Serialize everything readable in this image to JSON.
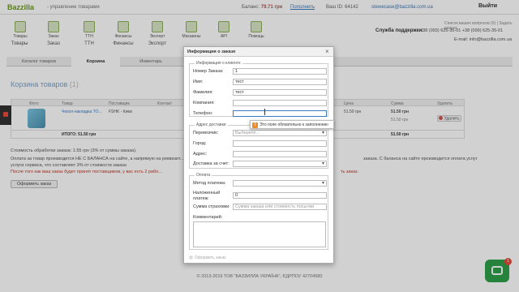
{
  "topbar": {
    "logo": "Bazzilla",
    "logo_sub": "- управление товарами",
    "balance_label": "Баланс:",
    "balance_value": "79.71 грн",
    "topup": "Пополнить",
    "uid": "Ваш ID: 64142",
    "email": "stewecase@bazzilla.com.ua",
    "logout": "Выйти"
  },
  "iconbar": {
    "items": [
      {
        "label": "Товары",
        "icon": "stack-icon"
      },
      {
        "label": "Заказ",
        "icon": "cart-icon"
      },
      {
        "label": "ТТН",
        "icon": "document-icon"
      },
      {
        "label": "Финансы",
        "icon": "money-icon"
      },
      {
        "label": "Экспорт",
        "icon": "export-icon"
      },
      {
        "label": "Магазины",
        "icon": "store-icon"
      },
      {
        "label": "API",
        "icon": "gear-icon"
      },
      {
        "label": "Помощь",
        "icon": "help-icon"
      }
    ],
    "quick_links": "Список ваших вопросов (0) | Задать вопрос",
    "support_label": "Служба поддержки:",
    "phones": "+38 (093) 625-35-01  +38 (099) 625-35-01",
    "mail": "E-mail: info@bazzilla.com.ua"
  },
  "tabs_top": [
    "Товары",
    "Заказ",
    "ТТН",
    "Финансы",
    "Экспорт",
    "Магазины",
    "API",
    "Помощь"
  ],
  "tabs_second": [
    "Каталог товаров",
    "Корзина",
    "Инвентарь",
    "",
    "",
    ""
  ],
  "cart": {
    "title": "Корзина товаров",
    "count": "(1)",
    "headers": [
      "Фото",
      "Товар",
      "Поставщик",
      "Контакт",
      "Цена",
      "Сумма",
      "Удалить"
    ],
    "row": {
      "product": "Чехол-накладка TO...",
      "supplier": "FSHK - Киев",
      "price": "51.50 грн",
      "sum": "51.50 грн",
      "sum2": "51.50 грн",
      "delete": "Удалить"
    },
    "total_label": "ИТОГО: 51.50 грн",
    "total_sum": "51.50 грн"
  },
  "info": {
    "line1": "Стоимость обработки заказа: 1.55 грн (3% от суммы заказа).",
    "line2": "Оплата за товар производится НЕ С БАЛАНСА на сайте, а напрямую на реквизит...",
    "line3": "услуги сервиса, что составляет 3% от стоимости заказа",
    "line4": "После того как ваш заказ будет принят поставщиком, у вас есть 2 рабо...",
    "right2": "заказа. С баланса на сайте производится оплата услуг",
    "right4": "ть заказ.",
    "order_button": "Оформить заказ"
  },
  "footer": "© 2013-2019 ТОВ \"БАЗЗИЛЛА УКРАЇНА\", ЄДРПОУ 42704580",
  "chat": {
    "badge": "1"
  },
  "modal": {
    "title": "Информация о заказе",
    "close": "×",
    "client_legend": "Информация о клиенте",
    "fields_client": [
      {
        "label": "Номер Заказа:",
        "value": "1"
      },
      {
        "label": "Имя:",
        "value": "тест"
      },
      {
        "label": "Фамилия:",
        "value": "тест"
      },
      {
        "label": "Компания:",
        "value": ""
      },
      {
        "label": "Телефон:",
        "value": ""
      }
    ],
    "delivery_legend": "Адрес доставки",
    "fields_delivery": [
      {
        "label": "Перевозчик:",
        "value": "Выберите..."
      },
      {
        "label": "Город:",
        "value": ""
      },
      {
        "label": "Адрес:",
        "value": ""
      },
      {
        "label": "Доставка за счет:",
        "value": ""
      }
    ],
    "payment_legend": "Оплата",
    "payment_method_label": "Метод платежа:",
    "payment_method_value": "",
    "cod_label": "Наложенный платеж:",
    "cod_value": "0",
    "insurance_label": "Сумма страховки:",
    "insurance_placeholder": "Сумма заказа или стоимость посылки",
    "comment_label": "Комментарий:",
    "submit": "Оформить заказ",
    "tooltip": "Это поле обязательно к заполнению"
  }
}
